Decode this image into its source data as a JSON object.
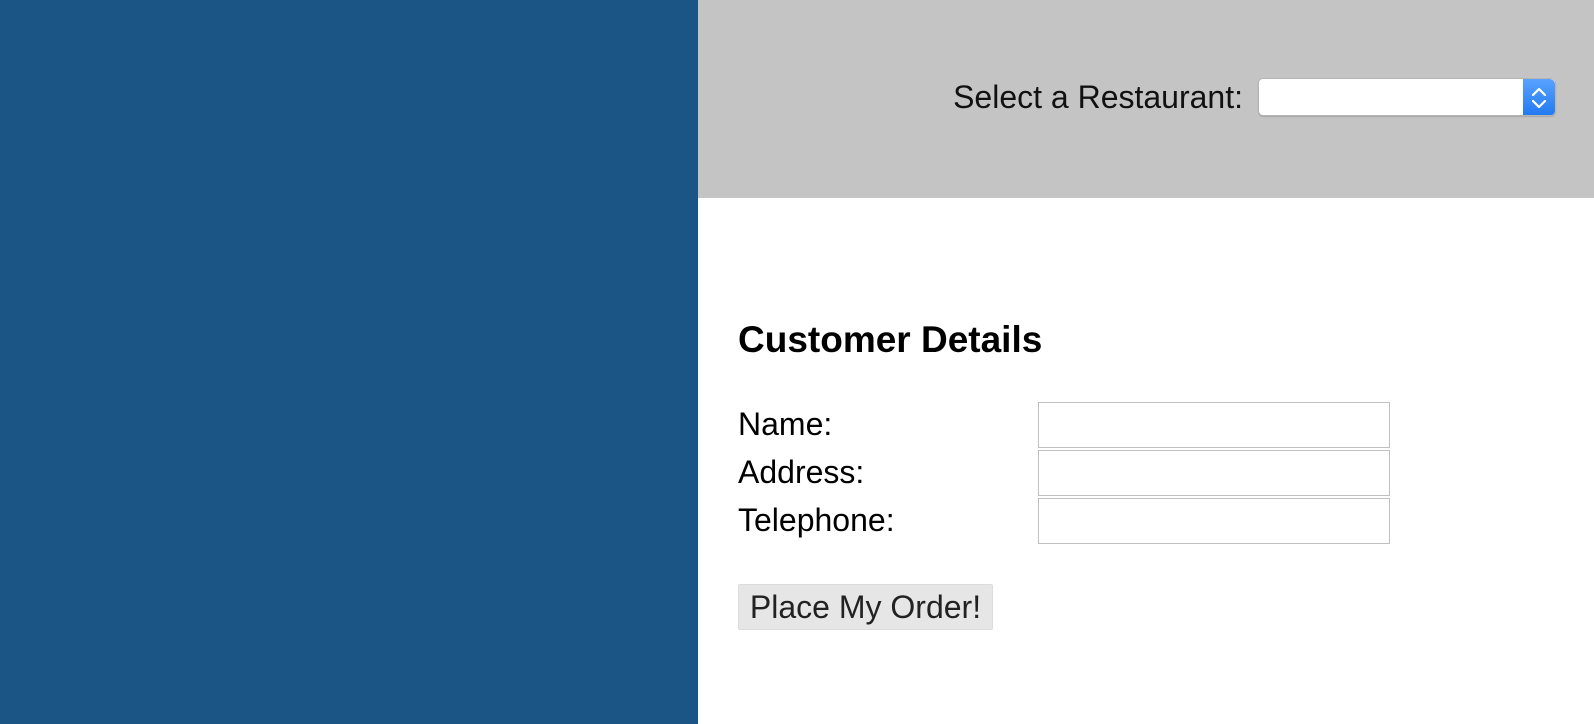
{
  "colors": {
    "left_panel": "#1b5586",
    "header_bar": "#c5c4c5",
    "select_accent": "#2b82f5"
  },
  "header": {
    "restaurant_label": "Select a Restaurant:",
    "restaurant_select_value": "",
    "stepper_icon": "up-down-chevron-icon"
  },
  "customer_details": {
    "title": "Customer Details",
    "fields": [
      {
        "label": "Name:",
        "value": ""
      },
      {
        "label": "Address:",
        "value": ""
      },
      {
        "label": "Telephone:",
        "value": ""
      }
    ],
    "submit_label": "Place My Order!"
  }
}
